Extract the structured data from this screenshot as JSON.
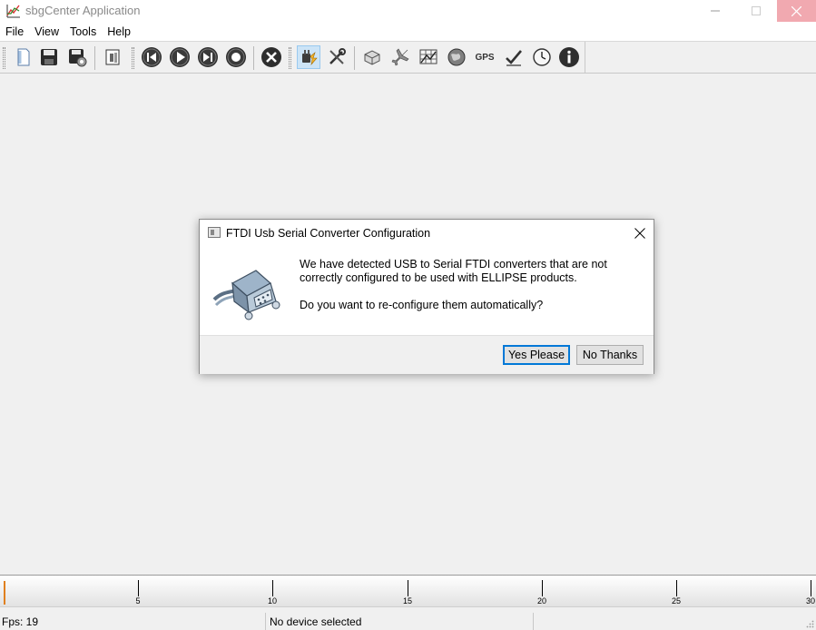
{
  "window": {
    "title": "sbgCenter Application",
    "icons": {
      "app": "chart-app-icon",
      "minimize": "minimize-icon",
      "maximize": "maximize-icon",
      "close": "close-icon"
    },
    "close_hover_color": "#f1a9b0"
  },
  "menu": {
    "items": [
      "File",
      "View",
      "Tools",
      "Help"
    ]
  },
  "toolbar": {
    "gps_label": "GPS",
    "buttons": [
      "new-file-icon",
      "save-icon",
      "save-settings-icon",
      "device-info-icon",
      "skip-back-icon",
      "play-icon",
      "skip-forward-icon",
      "stop-icon",
      "close-circle-icon",
      "connect-plug-icon",
      "tools-icon",
      "cube-icon",
      "airplane-icon",
      "grid-map-icon",
      "globe-icon",
      "gps-icon",
      "checkmark-pen-icon",
      "clock-icon",
      "info-icon"
    ],
    "active_button": "connect-plug-icon"
  },
  "dialog": {
    "title": "FTDI Usb Serial Converter Configuration",
    "message": "We have detected USB to Serial FTDI converters that are not correctly configured to be used with ELLIPSE products.",
    "question": "Do you want to re-configure them automatically?",
    "yes_label": "Yes Please",
    "no_label": "No Thanks",
    "picture_icon": "serial-connector-icon",
    "default_button_color": "#0078d7"
  },
  "timeline": {
    "ticks": [
      "5",
      "10",
      "15",
      "20",
      "25",
      "30"
    ],
    "cursor_color": "#e0801f"
  },
  "status": {
    "fps": "Fps: 19",
    "device": "No device selected"
  }
}
